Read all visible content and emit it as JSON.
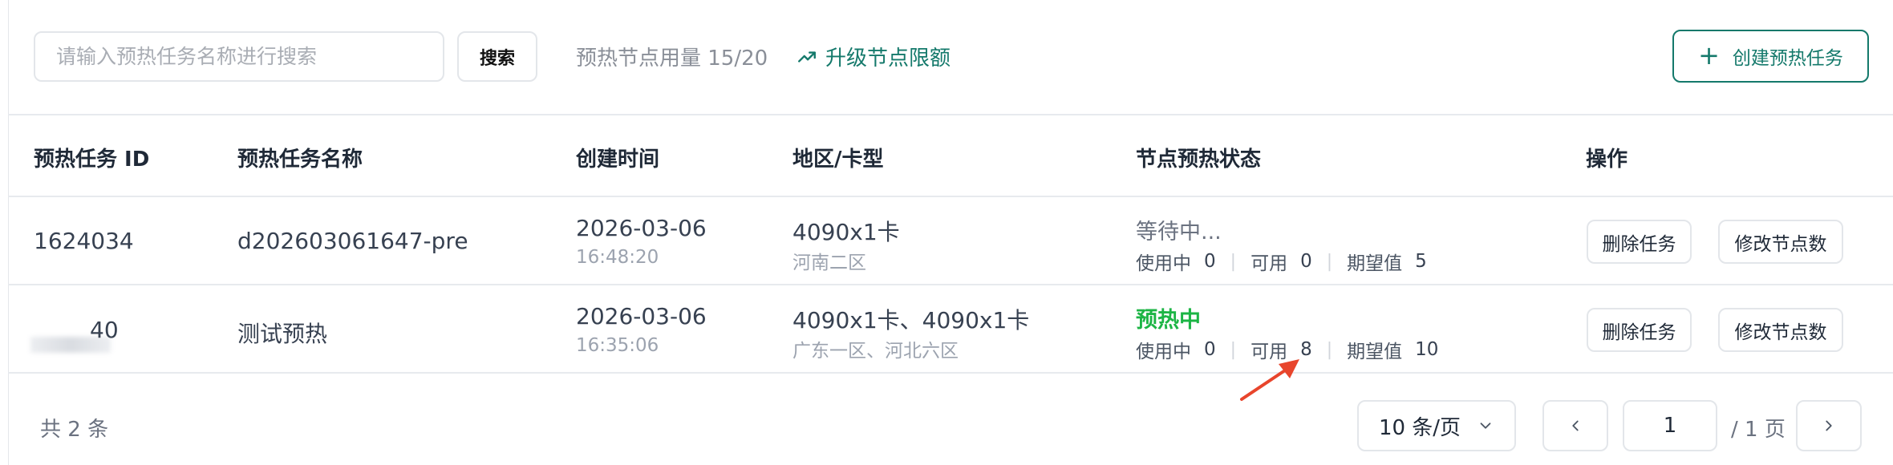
{
  "toolbar": {
    "search_placeholder": "请输入预热任务名称进行搜索",
    "search_label": "搜索",
    "usage_text": "预热节点用量 15/20",
    "upgrade_label": "升级节点限额",
    "create_label": "创建预热任务"
  },
  "table": {
    "headers": [
      "预热任务 ID",
      "预热任务名称",
      "创建时间",
      "地区/卡型",
      "节点预热状态",
      "操作"
    ],
    "rows": [
      {
        "id": "1624034",
        "name": "d202603061647-pre",
        "date": "2026-03-06",
        "time": "16:48:20",
        "card": "4090x1卡",
        "region": "河南二区",
        "status": "等待中...",
        "in_use_label": "使用中",
        "in_use": "0",
        "available_label": "可用",
        "available": "0",
        "expected_label": "期望值",
        "expected": "5",
        "delete_label": "删除任务",
        "modify_label": "修改节点数"
      },
      {
        "id": "40",
        "name": "测试预热",
        "date": "2026-03-06",
        "time": "16:35:06",
        "card": "4090x1卡、4090x1卡",
        "region": "广东一区、河北六区",
        "status": "预热中",
        "in_use_label": "使用中",
        "in_use": "0",
        "available_label": "可用",
        "available": "8",
        "expected_label": "期望值",
        "expected": "10",
        "delete_label": "删除任务",
        "modify_label": "修改节点数"
      }
    ]
  },
  "footer": {
    "total": "共 2 条",
    "page_size": "10 条/页",
    "current_page": "1",
    "page_total": "/ 1 页"
  },
  "colors": {
    "accent": "#14796b",
    "active_status": "#1cb545",
    "annotation_arrow": "#e8452c"
  },
  "icons": {
    "upgrade": "trending-up-icon",
    "create": "plus-icon",
    "page_size": "chevron-down-icon",
    "prev": "chevron-left-icon",
    "next": "chevron-right-icon",
    "annotation": "red-arrow-icon"
  }
}
